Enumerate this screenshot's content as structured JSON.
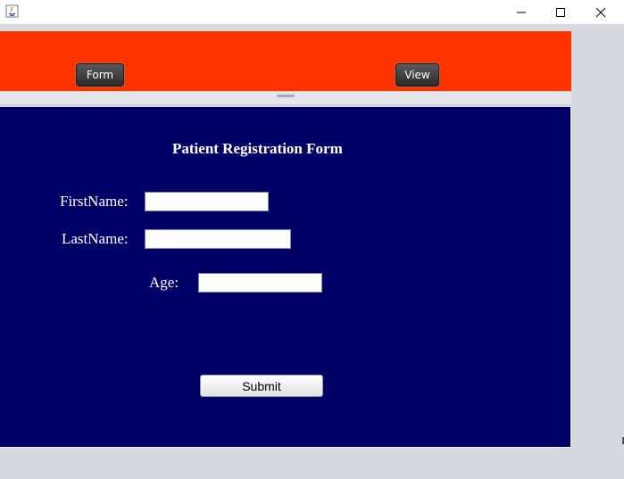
{
  "window": {
    "icon": "java-icon",
    "controls": {
      "minimize": "minimize-icon",
      "maximize": "maximize-icon",
      "close": "close-icon"
    }
  },
  "nav": {
    "form_label": "Form",
    "view_label": "View"
  },
  "form": {
    "title": "Patient Registration Form",
    "first_name_label": "FirstName:",
    "first_name_value": "",
    "last_name_label": "LastName:",
    "last_name_value": "",
    "age_label": "Age:",
    "age_value": "",
    "submit_label": "Submit"
  },
  "colors": {
    "top_panel": "#ff3300",
    "form_panel": "#000066",
    "nav_button": "#2b2b2b"
  }
}
